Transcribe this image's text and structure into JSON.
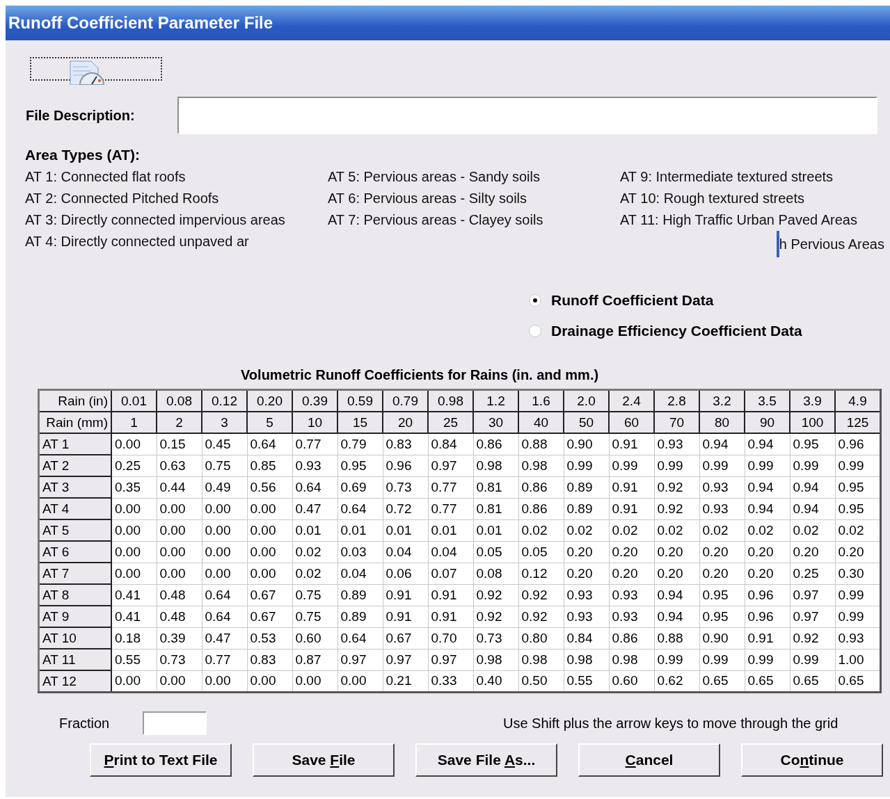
{
  "window": {
    "title": "Runoff Coefficient Parameter File"
  },
  "file_description": {
    "label": "File Description:"
  },
  "area_types": {
    "heading": "Area Types (AT):",
    "columns": [
      [
        "AT 1: Connected flat roofs",
        "AT 2: Connected Pitched Roofs",
        "AT 3: Directly connected impervious areas",
        "AT 4: Directly connected unpaved ar"
      ],
      [
        "AT 5: Pervious areas - Sandy soils",
        "AT 6: Pervious areas - Silty soils",
        "AT 7: Pervious areas - Clayey soils"
      ],
      [
        "AT 9: Intermediate textured streets",
        "AT 10: Rough textured streets",
        "AT 11: High Traffic Urban Paved Areas"
      ]
    ],
    "partial_item": "h Pervious Areas"
  },
  "data_options": [
    {
      "label": "Runoff Coefficient Data",
      "selected": true
    },
    {
      "label": "Drainage Efficiency Coefficient Data",
      "selected": false
    }
  ],
  "table": {
    "title": "Volumetric Runoff Coefficients for Rains (in. and mm.)",
    "header_rows": [
      [
        "Rain (in)",
        "0.01",
        "0.08",
        "0.12",
        "0.20",
        "0.39",
        "0.59",
        "0.79",
        "0.98",
        "1.2",
        "1.6",
        "2.0",
        "2.4",
        "2.8",
        "3.2",
        "3.5",
        "3.9",
        "4.9"
      ],
      [
        "Rain (mm)",
        "1",
        "2",
        "3",
        "5",
        "10",
        "15",
        "20",
        "25",
        "30",
        "40",
        "50",
        "60",
        "70",
        "80",
        "90",
        "100",
        "125"
      ]
    ],
    "rows": [
      [
        "AT 1",
        "0.00",
        "0.15",
        "0.45",
        "0.64",
        "0.77",
        "0.79",
        "0.83",
        "0.84",
        "0.86",
        "0.88",
        "0.90",
        "0.91",
        "0.93",
        "0.94",
        "0.94",
        "0.95",
        "0.96"
      ],
      [
        "AT 2",
        "0.25",
        "0.63",
        "0.75",
        "0.85",
        "0.93",
        "0.95",
        "0.96",
        "0.97",
        "0.98",
        "0.98",
        "0.99",
        "0.99",
        "0.99",
        "0.99",
        "0.99",
        "0.99",
        "0.99"
      ],
      [
        "AT 3",
        "0.35",
        "0.44",
        "0.49",
        "0.56",
        "0.64",
        "0.69",
        "0.73",
        "0.77",
        "0.81",
        "0.86",
        "0.89",
        "0.91",
        "0.92",
        "0.93",
        "0.94",
        "0.94",
        "0.95"
      ],
      [
        "AT 4",
        "0.00",
        "0.00",
        "0.00",
        "0.00",
        "0.47",
        "0.64",
        "0.72",
        "0.77",
        "0.81",
        "0.86",
        "0.89",
        "0.91",
        "0.92",
        "0.93",
        "0.94",
        "0.94",
        "0.95"
      ],
      [
        "AT 5",
        "0.00",
        "0.00",
        "0.00",
        "0.00",
        "0.01",
        "0.01",
        "0.01",
        "0.01",
        "0.01",
        "0.02",
        "0.02",
        "0.02",
        "0.02",
        "0.02",
        "0.02",
        "0.02",
        "0.02"
      ],
      [
        "AT 6",
        "0.00",
        "0.00",
        "0.00",
        "0.00",
        "0.02",
        "0.03",
        "0.04",
        "0.04",
        "0.05",
        "0.05",
        "0.20",
        "0.20",
        "0.20",
        "0.20",
        "0.20",
        "0.20",
        "0.20"
      ],
      [
        "AT 7",
        "0.00",
        "0.00",
        "0.00",
        "0.00",
        "0.02",
        "0.04",
        "0.06",
        "0.07",
        "0.08",
        "0.12",
        "0.20",
        "0.20",
        "0.20",
        "0.20",
        "0.20",
        "0.25",
        "0.30"
      ],
      [
        "AT 8",
        "0.41",
        "0.48",
        "0.64",
        "0.67",
        "0.75",
        "0.89",
        "0.91",
        "0.91",
        "0.92",
        "0.92",
        "0.93",
        "0.93",
        "0.94",
        "0.95",
        "0.96",
        "0.97",
        "0.99"
      ],
      [
        "AT 9",
        "0.41",
        "0.48",
        "0.64",
        "0.67",
        "0.75",
        "0.89",
        "0.91",
        "0.91",
        "0.92",
        "0.92",
        "0.93",
        "0.93",
        "0.94",
        "0.95",
        "0.96",
        "0.97",
        "0.99"
      ],
      [
        "AT 10",
        "0.18",
        "0.39",
        "0.47",
        "0.53",
        "0.60",
        "0.64",
        "0.67",
        "0.70",
        "0.73",
        "0.80",
        "0.84",
        "0.86",
        "0.88",
        "0.90",
        "0.91",
        "0.92",
        "0.93"
      ],
      [
        "AT 11",
        "0.55",
        "0.73",
        "0.77",
        "0.83",
        "0.87",
        "0.97",
        "0.97",
        "0.97",
        "0.98",
        "0.98",
        "0.98",
        "0.98",
        "0.99",
        "0.99",
        "0.99",
        "0.99",
        "1.00"
      ],
      [
        "AT 12",
        "0.00",
        "0.00",
        "0.00",
        "0.00",
        "0.00",
        "0.00",
        "0.21",
        "0.33",
        "0.40",
        "0.50",
        "0.55",
        "0.60",
        "0.62",
        "0.65",
        "0.65",
        "0.65",
        "0.65"
      ]
    ]
  },
  "fraction": {
    "label": "Fraction"
  },
  "hint": "Use Shift plus the arrow keys to move through the grid",
  "buttons": [
    {
      "key": "P",
      "after": "rint to Text File"
    },
    {
      "before": "Save ",
      "key": "F",
      "after": "ile"
    },
    {
      "before": "Save File ",
      "key": "A",
      "after": "s..."
    },
    {
      "key": "C",
      "after": "ancel"
    },
    {
      "before": "Co",
      "key": "n",
      "after": "tinue"
    }
  ]
}
